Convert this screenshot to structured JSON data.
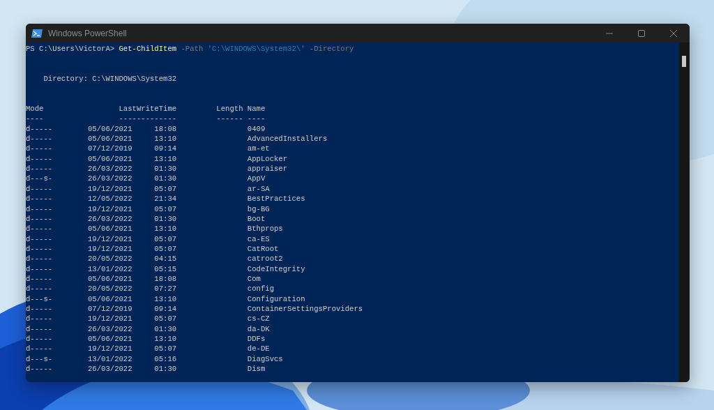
{
  "window": {
    "title": "Windows PowerShell"
  },
  "command_line": [
    {
      "kind": "prompt",
      "text": "PS C:\\Users\\VictorA>"
    },
    {
      "kind": "cmdlet",
      "text": "Get-ChildItem"
    },
    {
      "kind": "parameter",
      "text": "-Path"
    },
    {
      "kind": "string",
      "text": "'C:\\WINDOWS\\System32\\'"
    },
    {
      "kind": "parameter",
      "text": "-Directory"
    }
  ],
  "directory_line": "Directory: C:\\WINDOWS\\System32",
  "columns": [
    {
      "header": "Mode",
      "rule": "----"
    },
    {
      "header": "LastWriteTime",
      "rule": "-------------"
    },
    {
      "header": "Length",
      "rule": "------"
    },
    {
      "header": "Name",
      "rule": "----"
    }
  ],
  "rows": [
    {
      "mode": "d-----",
      "date": "05/06/2021",
      "time": "18:08",
      "name": "0409"
    },
    {
      "mode": "d-----",
      "date": "05/06/2021",
      "time": "13:10",
      "name": "AdvancedInstallers"
    },
    {
      "mode": "d-----",
      "date": "07/12/2019",
      "time": "09:14",
      "name": "am-et"
    },
    {
      "mode": "d-----",
      "date": "05/06/2021",
      "time": "13:10",
      "name": "AppLocker"
    },
    {
      "mode": "d-----",
      "date": "26/03/2022",
      "time": "01:30",
      "name": "appraiser"
    },
    {
      "mode": "d---s-",
      "date": "26/03/2022",
      "time": "01:30",
      "name": "AppV"
    },
    {
      "mode": "d-----",
      "date": "19/12/2021",
      "time": "05:07",
      "name": "ar-SA"
    },
    {
      "mode": "d-----",
      "date": "12/05/2022",
      "time": "21:34",
      "name": "BestPractices"
    },
    {
      "mode": "d-----",
      "date": "19/12/2021",
      "time": "05:07",
      "name": "bg-BG"
    },
    {
      "mode": "d-----",
      "date": "26/03/2022",
      "time": "01:30",
      "name": "Boot"
    },
    {
      "mode": "d-----",
      "date": "05/06/2021",
      "time": "13:10",
      "name": "Bthprops"
    },
    {
      "mode": "d-----",
      "date": "19/12/2021",
      "time": "05:07",
      "name": "ca-ES"
    },
    {
      "mode": "d-----",
      "date": "19/12/2021",
      "time": "05:07",
      "name": "CatRoot"
    },
    {
      "mode": "d-----",
      "date": "20/05/2022",
      "time": "04:15",
      "name": "catroot2"
    },
    {
      "mode": "d-----",
      "date": "13/01/2022",
      "time": "05:15",
      "name": "CodeIntegrity"
    },
    {
      "mode": "d-----",
      "date": "05/06/2021",
      "time": "18:08",
      "name": "Com"
    },
    {
      "mode": "d-----",
      "date": "20/05/2022",
      "time": "07:27",
      "name": "config"
    },
    {
      "mode": "d---s-",
      "date": "05/06/2021",
      "time": "13:10",
      "name": "Configuration"
    },
    {
      "mode": "d-----",
      "date": "07/12/2019",
      "time": "09:14",
      "name": "ContainerSettingsProviders"
    },
    {
      "mode": "d-----",
      "date": "19/12/2021",
      "time": "05:07",
      "name": "cs-CZ"
    },
    {
      "mode": "d-----",
      "date": "26/03/2022",
      "time": "01:30",
      "name": "da-DK"
    },
    {
      "mode": "d-----",
      "date": "05/06/2021",
      "time": "13:10",
      "name": "DDFs"
    },
    {
      "mode": "d-----",
      "date": "19/12/2021",
      "time": "05:07",
      "name": "de-DE"
    },
    {
      "mode": "d---s-",
      "date": "13/01/2022",
      "time": "05:16",
      "name": "DiagSvcs"
    },
    {
      "mode": "d-----",
      "date": "26/03/2022",
      "time": "01:30",
      "name": "Dism"
    }
  ]
}
